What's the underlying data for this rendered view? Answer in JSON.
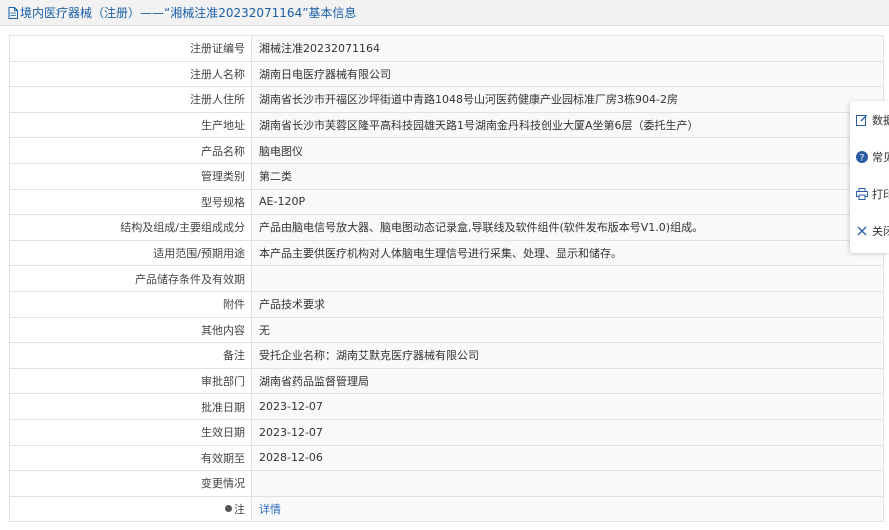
{
  "header": {
    "title": "境内医疗器械（注册）——“湘械注准20232071164”基本信息"
  },
  "rows": [
    {
      "label": "注册证编号",
      "value": "湘械注准20232071164"
    },
    {
      "label": "注册人名称",
      "value": "湖南日电医疗器械有限公司"
    },
    {
      "label": "注册人住所",
      "value": "湖南省长沙市开福区沙坪街道中青路1048号山河医药健康产业园标准厂房3栋904-2房"
    },
    {
      "label": "生产地址",
      "value": "湖南省长沙市芙蓉区隆平高科技园雄天路1号湖南金丹科技创业大厦A坐第6层（委托生产）"
    },
    {
      "label": "产品名称",
      "value": "脑电图仪"
    },
    {
      "label": "管理类别",
      "value": "第二类"
    },
    {
      "label": "型号规格",
      "value": "AE-120P"
    },
    {
      "label": "结构及组成/主要组成成分",
      "value": "产品由脑电信号放大器、脑电图动态记录盒,导联线及软件组件(软件发布版本号V1.0)组成。"
    },
    {
      "label": "适用范围/预期用途",
      "value": "本产品主要供医疗机构对人体脑电生理信号进行采集、处理、显示和储存。"
    },
    {
      "label": "产品储存条件及有效期",
      "value": ""
    },
    {
      "label": "附件",
      "value": "产品技术要求"
    },
    {
      "label": "其他内容",
      "value": "无"
    },
    {
      "label": "备注",
      "value": "受托企业名称：湖南艾默克医疗器械有限公司"
    },
    {
      "label": "审批部门",
      "value": "湖南省药品监督管理局"
    },
    {
      "label": "批准日期",
      "value": "2023-12-07"
    },
    {
      "label": "生效日期",
      "value": "2023-12-07"
    },
    {
      "label": "有效期至",
      "value": "2028-12-06"
    },
    {
      "label": "变更情况",
      "value": ""
    }
  ],
  "note_row": {
    "label": "注",
    "value": "详情"
  },
  "side_panel": {
    "items": [
      {
        "label": "数据",
        "icon": "edit-icon"
      },
      {
        "label": "常见",
        "icon": "help-icon"
      },
      {
        "label": "打印",
        "icon": "print-icon"
      },
      {
        "label": "关闭",
        "icon": "close-icon"
      }
    ]
  },
  "colors": {
    "title": "#1a5fa8",
    "link": "#2b6cc4",
    "border": "#e1e1e1"
  }
}
